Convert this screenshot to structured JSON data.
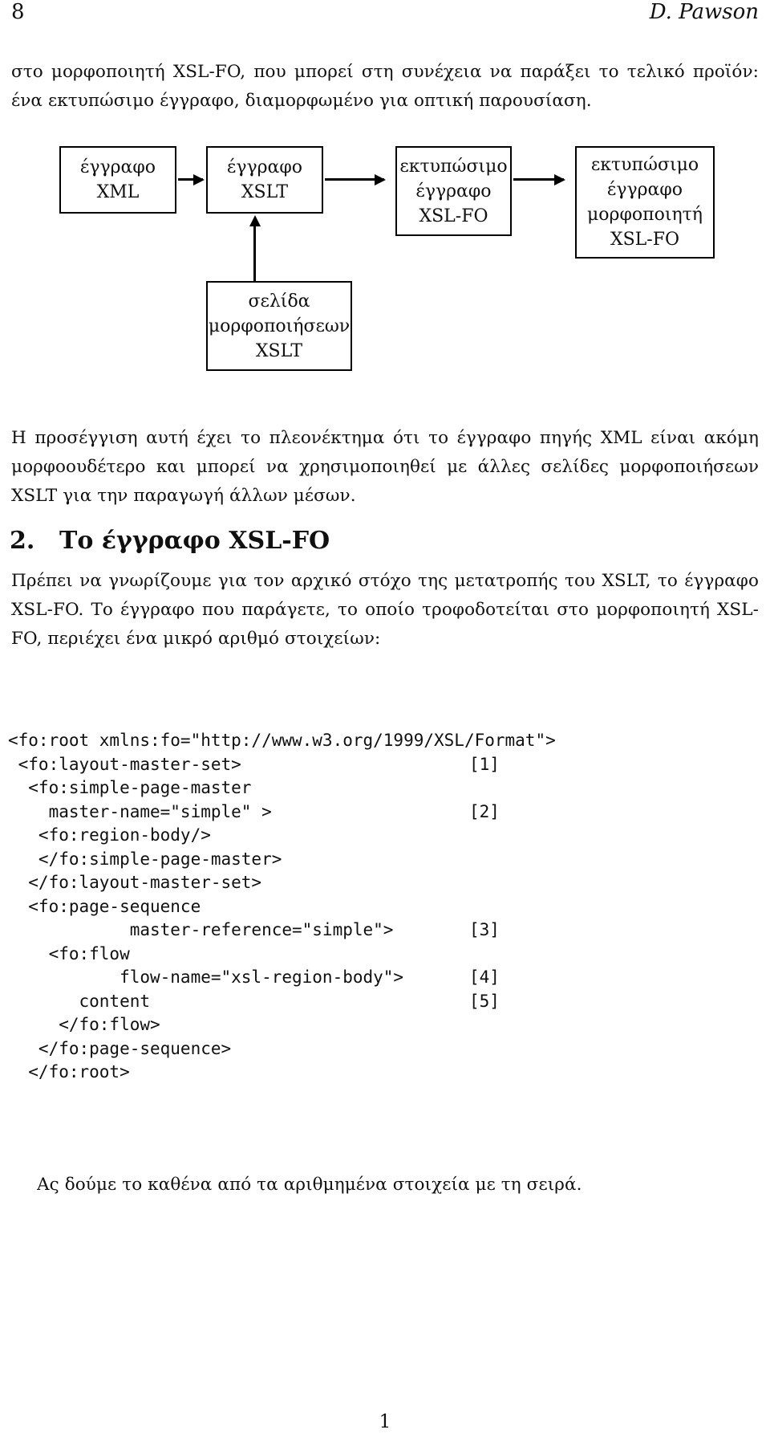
{
  "running_head": {
    "folio": "8",
    "author": "D. Pawson"
  },
  "intro_paragraph": "στο μορφοποιητή XSL-FO, που μπορεί στη συνέχεια να παράξει το τελικό προϊόν: ένα εκτυπώσιμο έγγραφο, διαμορφωμένο για οπτική παρουσίαση.",
  "diagram": {
    "boxes": [
      {
        "id": "xml",
        "lines": [
          "έγγραφο",
          "XML"
        ]
      },
      {
        "id": "xslt",
        "lines": [
          "έγγραφο",
          "XSLT"
        ]
      },
      {
        "id": "foprint",
        "lines": [
          "εκτυπώσιμο",
          "έγγραφο",
          "XSL-FO"
        ]
      },
      {
        "id": "formatter",
        "lines": [
          "εκτυπώσιμο",
          "έγγραφο",
          "μορφοποιητή",
          "XSL-FO"
        ]
      },
      {
        "id": "stylesheet",
        "lines": [
          "σελίδα",
          "μορφοποιήσεων",
          "XSLT"
        ]
      }
    ],
    "box_text": {
      "xml_l1": "έγγραφο",
      "xml_l2": "XML",
      "xslt_l1": "έγγραφο",
      "xslt_l2": "XSLT",
      "foprint_l1": "εκτυπώσιμο",
      "foprint_l2": "έγγραφο",
      "foprint_l3": "XSL-FO",
      "formatter_l1": "εκτυπώσιμο",
      "formatter_l2": "έγγραφο",
      "formatter_l3": "μορφοποιητή",
      "formatter_l4": "XSL-FO",
      "stylesheet_l1": "σελίδα",
      "stylesheet_l2": "μορφοποιήσεων",
      "stylesheet_l3": "XSLT"
    }
  },
  "approach_paragraph": "Η προσέγγιση αυτή έχει το πλεονέκτημα ότι το έγγραφο πηγής XML είναι ακόμη μορφοουδέτερο και μπορεί να χρησιμοποιηθεί με άλλες σελίδες μορφοποιήσεων XSLT για την παραγωγή άλλων μέσων.",
  "section": {
    "number": "2.",
    "title": "Το έγγραφο XSL-FO"
  },
  "goal_paragraph": "Πρέπει να γνωρίζουμε για τον αρχικό στόχο της μετατροπής του XSLT, το έγγραφο XSL-FO. Το έγγραφο που παράγετε, το οποίο τροφοδοτείται στο μορφοποιητή XSL-FO, περιέχει ένα μικρό αριθμό στοιχείων:",
  "code": {
    "lines": [
      {
        "text": "<fo:root xmlns:fo=\"http://www.w3.org/1999/XSL/Format\">",
        "ref": ""
      },
      {
        "text": " <fo:layout-master-set>",
        "ref": "[1]"
      },
      {
        "text": "  <fo:simple-page-master",
        "ref": ""
      },
      {
        "text": "    master-name=\"simple\" >",
        "ref": "[2]"
      },
      {
        "text": "   <fo:region-body/>",
        "ref": ""
      },
      {
        "text": "   </fo:simple-page-master>",
        "ref": ""
      },
      {
        "text": "  </fo:layout-master-set>",
        "ref": ""
      },
      {
        "text": "  <fo:page-sequence",
        "ref": ""
      },
      {
        "text": "            master-reference=\"simple\">",
        "ref": "[3]"
      },
      {
        "text": "    <fo:flow",
        "ref": ""
      },
      {
        "text": "           flow-name=\"xsl-region-body\">",
        "ref": "[4]"
      },
      {
        "text": "       content",
        "ref": "[5]"
      },
      {
        "text": "     </fo:flow>",
        "ref": ""
      },
      {
        "text": "   </fo:page-sequence>",
        "ref": ""
      },
      {
        "text": "  </fo:root>",
        "ref": ""
      }
    ]
  },
  "closing_paragraph": "Ας δούμε το καθένα από τα αριθμημένα στοιχεία με τη σειρά.",
  "page_folio": "1"
}
